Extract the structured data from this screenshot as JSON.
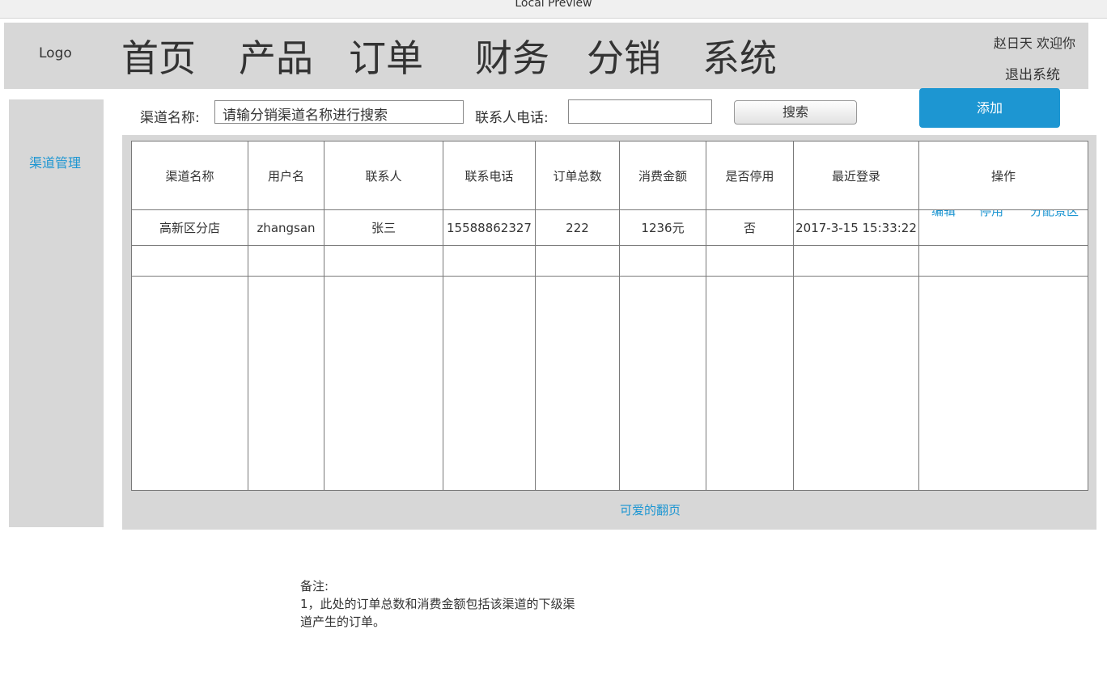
{
  "window": {
    "title": "Local Preview"
  },
  "header": {
    "logo": "Logo",
    "nav": [
      "首页",
      "产品",
      "订单",
      "财务",
      "分销",
      "系统"
    ],
    "greeting": "赵日天 欢迎你",
    "logout": "退出系统"
  },
  "sidebar": {
    "items": [
      "渠道管理"
    ]
  },
  "search": {
    "name_label": "渠道名称:",
    "name_value": "请输分销渠道名称进行搜索",
    "phone_label": "联系人电话:",
    "phone_value": "",
    "search_button": "搜索",
    "add_button": "添加"
  },
  "table": {
    "headers": [
      "渠道名称",
      "用户名",
      "联系人",
      "联系电话",
      "订单总数",
      "消费金额",
      "是否停用",
      "最近登录",
      "操作"
    ],
    "rows": [
      {
        "channel": "高新区分店",
        "username": "zhangsan",
        "contact": "张三",
        "phone": "15588862327",
        "orders": "222",
        "amount": "1236元",
        "disabled": "否",
        "last_login": "2017-3-15 15:33:22",
        "actions": [
          "编辑",
          "停用",
          "分配景区"
        ]
      }
    ]
  },
  "pagination": "可爱的翻页",
  "note": {
    "title": "备注:",
    "line1": "1，此处的订单总数和消费金额包括该渠道的下级渠",
    "line2": "道产生的订单。"
  }
}
